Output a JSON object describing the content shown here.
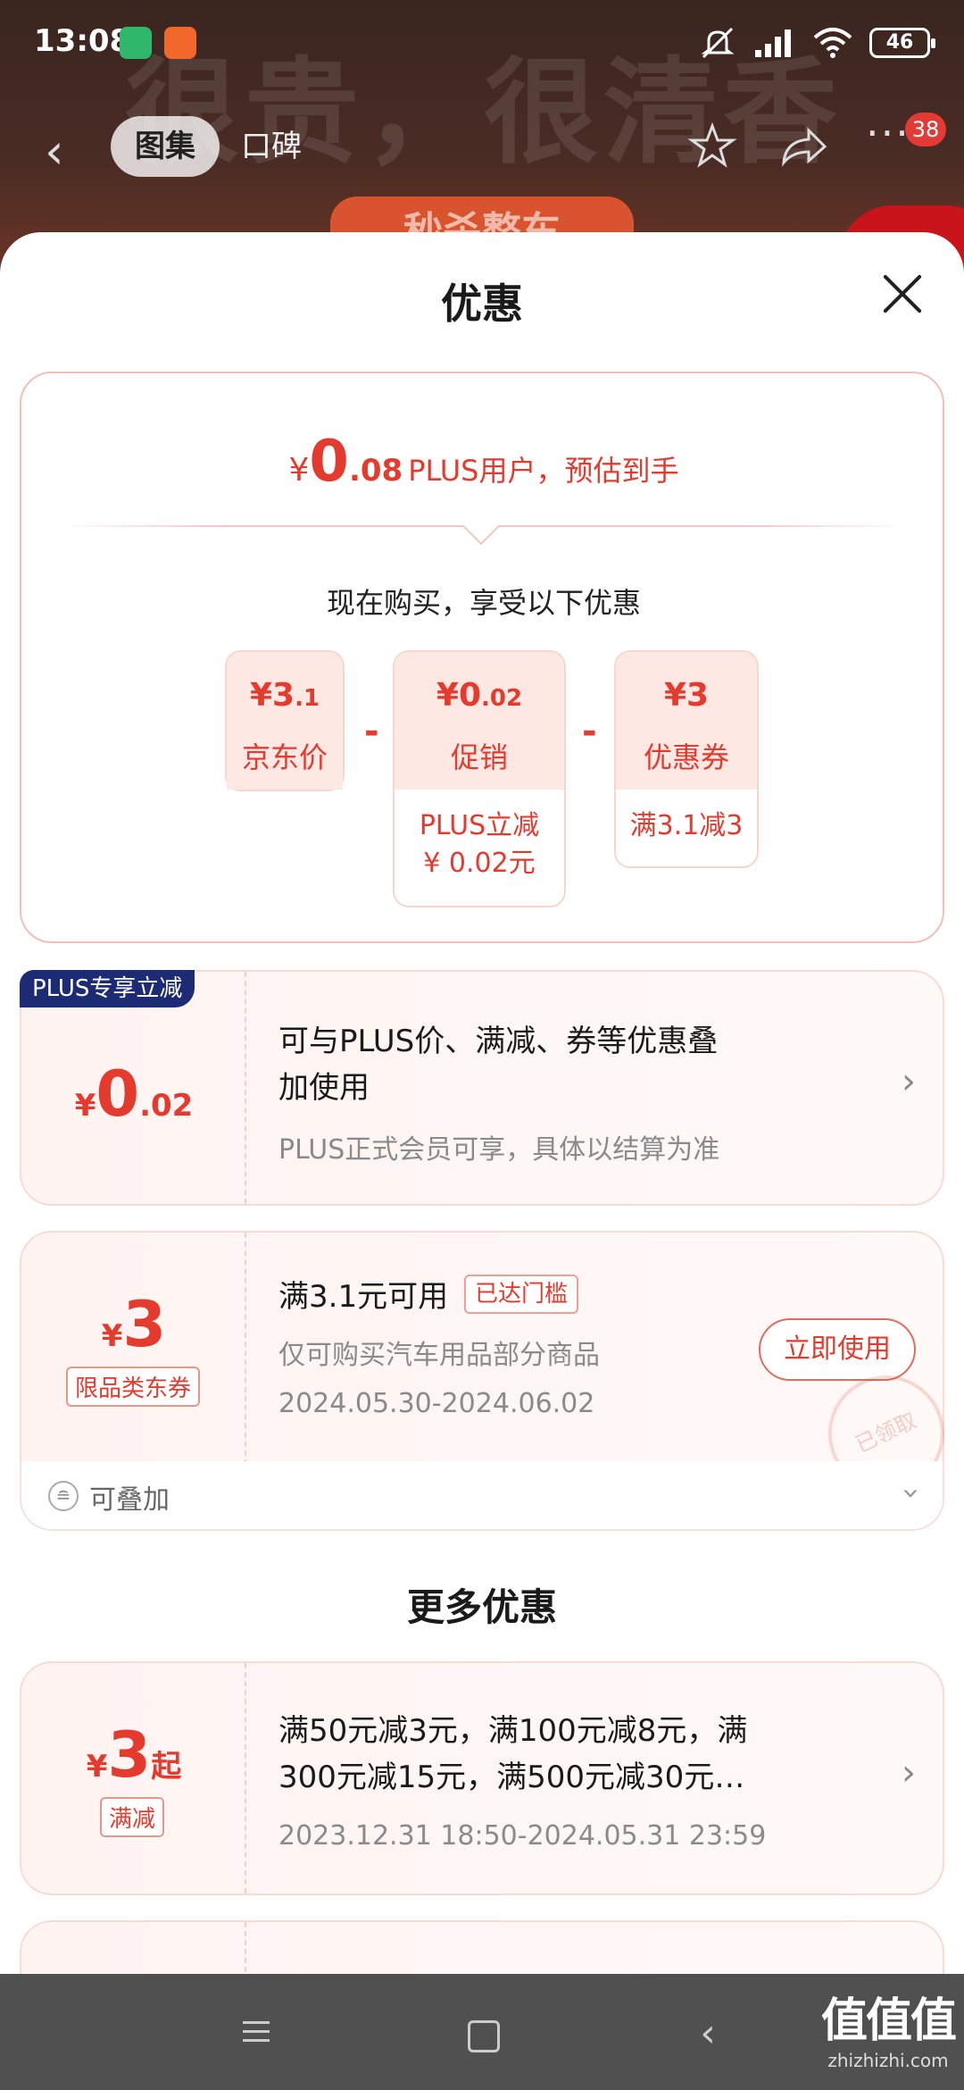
{
  "status_bar": {
    "time": "13:08",
    "battery": "46"
  },
  "background": {
    "headline": "很贵，很清香",
    "badge": "秒杀整车"
  },
  "top_nav": {
    "tab_active": "图集",
    "tab_other": "口碑",
    "count": "38"
  },
  "sheet": {
    "title": "优惠"
  },
  "summary": {
    "yen": "¥",
    "price_big": "0",
    "price_small": ".08",
    "price_label": "PLUS用户，预估到手",
    "now_buy": "现在购买，享受以下优惠",
    "jd_price": {
      "val": "¥3",
      "val_small": ".1",
      "name": "京东价"
    },
    "promo": {
      "val": "¥0",
      "val_small": ".02",
      "name": "促销",
      "detail_line1": "PLUS立减",
      "detail_line2": "¥ 0.02元"
    },
    "coupon": {
      "val": "¥3",
      "val_small": "",
      "name": "优惠券",
      "detail": "满3.1减3"
    },
    "minus1": "-",
    "minus2": "-"
  },
  "plus_coupon": {
    "badge": "PLUS专享立减",
    "yen": "¥",
    "amount_big": "0",
    "amount_small": ".02",
    "line1": "可与PLUS价、满减、券等优惠叠",
    "line2": "加使用",
    "sub": "PLUS正式会员可享，具体以结算为准"
  },
  "category_coupon": {
    "yen": "¥",
    "amount_big": "3",
    "tag": "限品类东券",
    "title": "满3.1元可用",
    "reached": "已达门槛",
    "desc": "仅可购买汽车用品部分商品",
    "date": "2024.05.30-2024.06.02",
    "button": "立即使用",
    "stamp": "已领取",
    "stack_label": "可叠加"
  },
  "more": {
    "title": "更多优惠",
    "item1": {
      "yen": "¥",
      "amount_big": "3",
      "amount_suffix": "起",
      "tag": "满减",
      "line1": "满50元减3元，满100元减8元，满",
      "line2": "300元减15元，满500元减30元…",
      "date": "2023.12.31 18:50-2024.05.31 23:59"
    }
  },
  "watermark": {
    "big": "值值值",
    "small": "zhizhizhi.com"
  },
  "colors": {
    "accent": "#e53a2e",
    "plus_badge": "#1d2b75",
    "nav_bar": "#505050"
  }
}
